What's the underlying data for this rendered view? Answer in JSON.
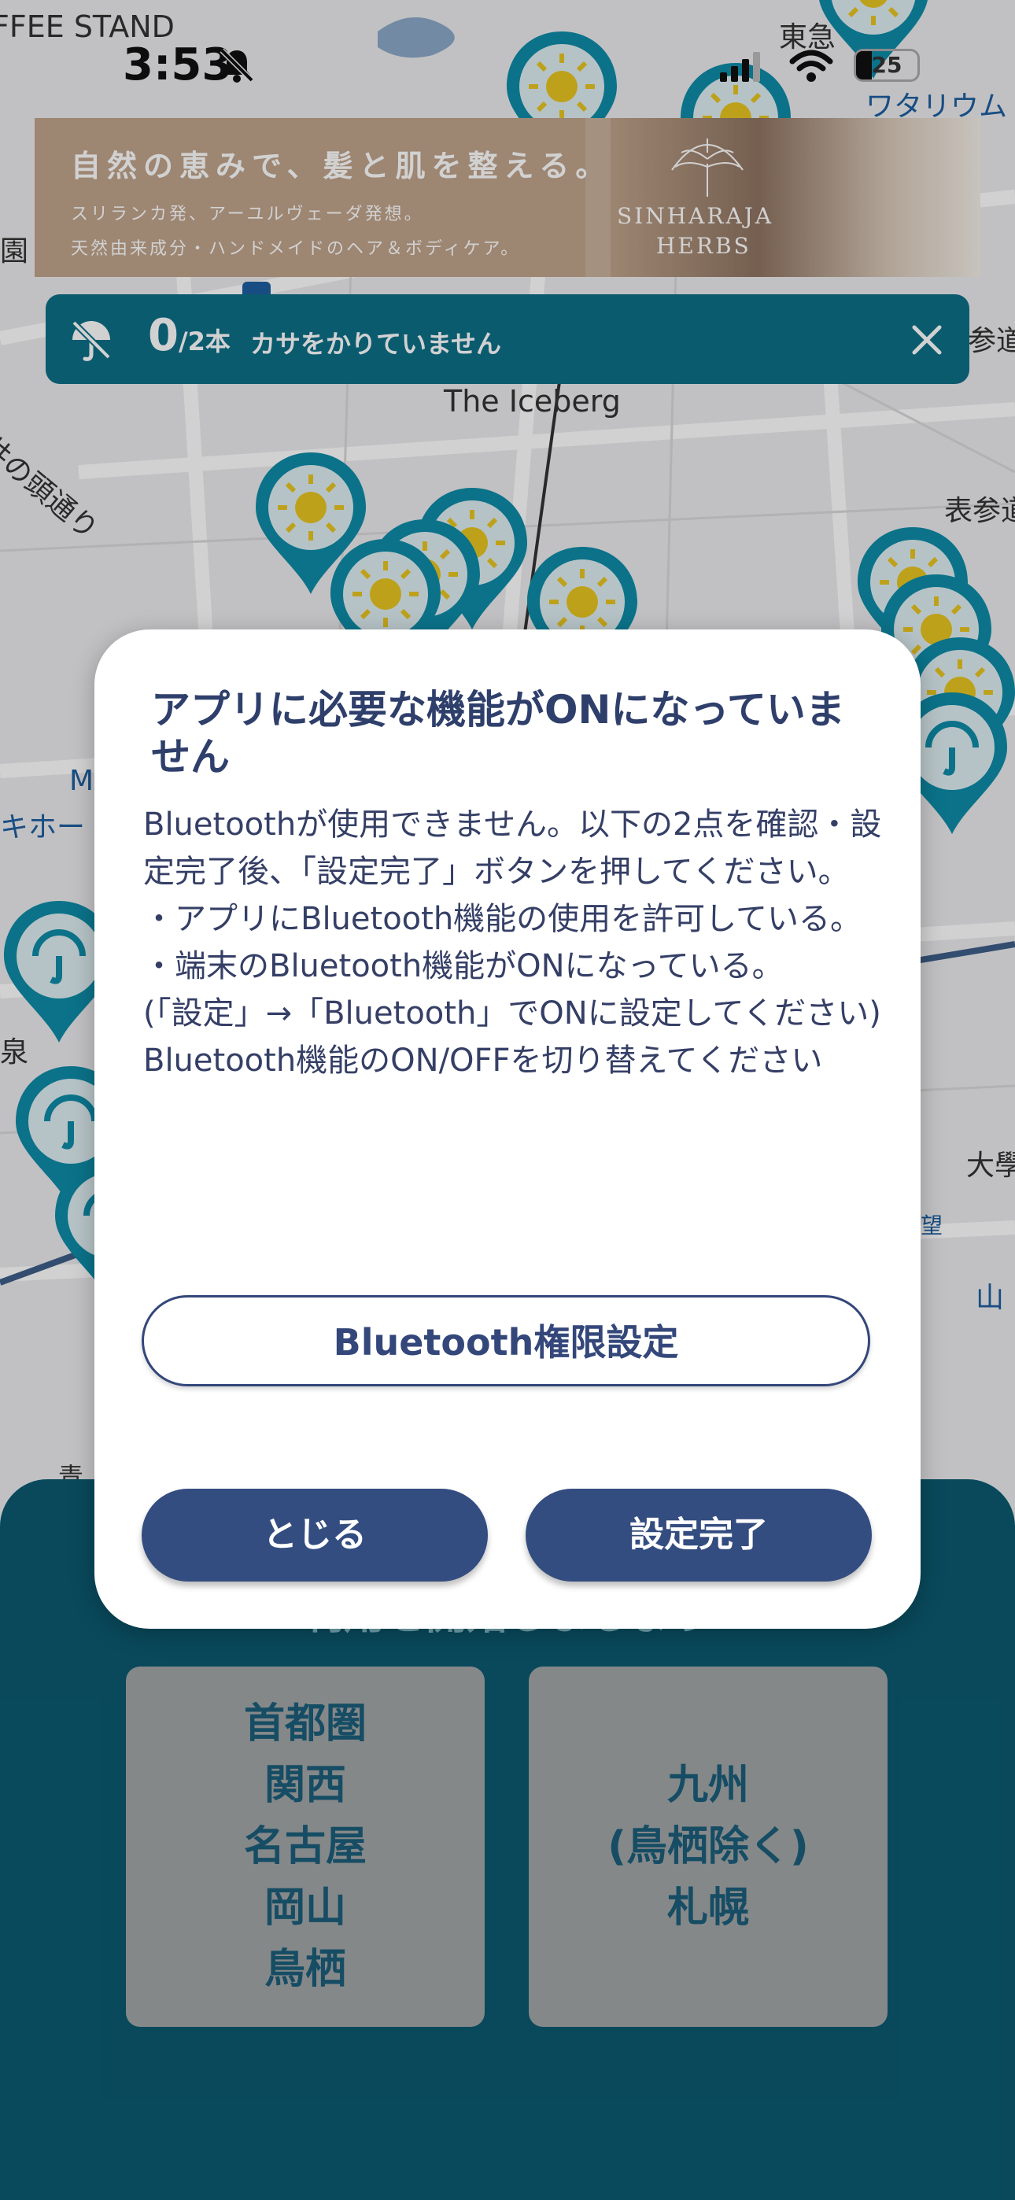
{
  "status_bar": {
    "time": "3:53",
    "battery": "25",
    "battery_level": 0.25
  },
  "banner": {
    "headline": "自然の恵みで、髪と肌を整える。",
    "sub1": "スリランカ発、アーユルヴェーダ発想。",
    "sub2": "天然由来成分・ハンドメイドのヘア＆ボディケア。",
    "brand_line1": "SINHARAJA",
    "brand_line2": "HERBS"
  },
  "umbrella_bar": {
    "count": "0",
    "max": "/2本",
    "status": "カサをかりていません"
  },
  "map": {
    "labels": [
      {
        "text": "FFEE STAND"
      },
      {
        "text": "東急"
      },
      {
        "text": "ワタリウム"
      },
      {
        "text": "園"
      },
      {
        "text": "参道"
      },
      {
        "text": "The Iceberg"
      },
      {
        "text": "井の頭通り"
      },
      {
        "text": "表参道"
      },
      {
        "text": "M"
      },
      {
        "text": "キホー"
      },
      {
        "text": "泉"
      },
      {
        "text": "大學"
      },
      {
        "text": "山"
      },
      {
        "text": "望"
      },
      {
        "text": "青"
      }
    ]
  },
  "modal": {
    "title": "アプリに必要な機能がONになっていません",
    "body": [
      "Bluetoothが使用できません。以下の2点を確認・設定完了後、「設定完了」ボタンを押してください。",
      "・アプリにBluetooth機能の使用を許可している。",
      "・端末のBluetooth機能がONになっている。",
      "(「設定」→「Bluetooth」でONに設定してください)",
      "Bluetooth機能のON/OFFを切り替えてください"
    ],
    "bt_settings_label": "Bluetooth権限設定",
    "close_label": "とじる",
    "done_label": "設定完了"
  },
  "bottom_sheet": {
    "heading": "利用を開始しましょう",
    "region_cards": [
      {
        "lines": [
          "首都圏",
          "関西",
          "名古屋",
          "岡山",
          "鳥栖"
        ]
      },
      {
        "lines": [
          "九州",
          "(鳥栖除く)",
          "札幌"
        ]
      }
    ]
  },
  "colors": {
    "teal_pin": "#0e8ca8",
    "pin_sun": "#e8c520",
    "modal_button": "#344d80",
    "sheet_bg": "#0b5a70"
  },
  "icons": {
    "bell_muted": "bell-slash-icon",
    "umbrella": "umbrella-icon",
    "close": "close-icon",
    "map_pin": "umbrella-stand-pin-icon"
  }
}
